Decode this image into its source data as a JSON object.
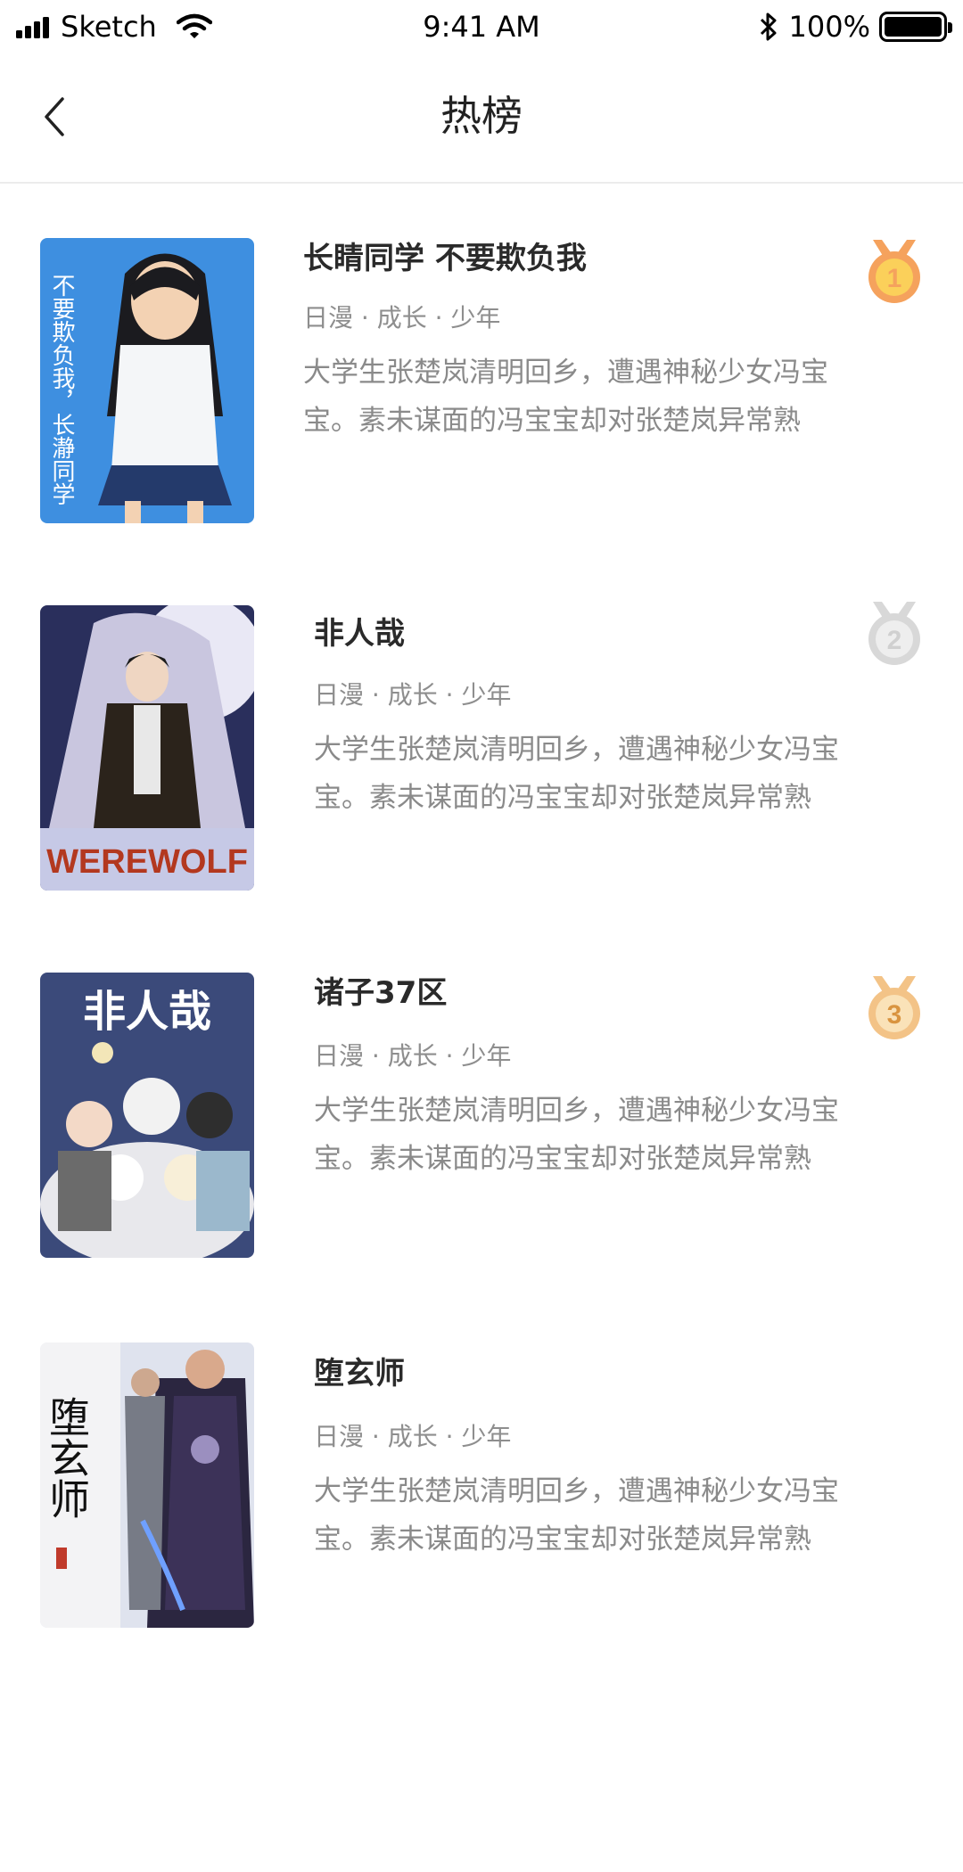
{
  "status_bar": {
    "carrier": "Sketch",
    "time": "9:41 AM",
    "battery": "100%",
    "icons": [
      "signal-icon",
      "wifi-icon",
      "bluetooth-icon",
      "battery-icon"
    ]
  },
  "nav": {
    "title": "热榜",
    "back_icon": "chevron-left-icon"
  },
  "rank_list": [
    {
      "rank": "1",
      "title": "长睛同学 不要欺负我",
      "tags": "日漫 · 成长 · 少年",
      "description": "大学生张楚岚清明回乡，遭遇神秘少女冯宝宝。素未谋面的冯宝宝却对张楚岚异常熟",
      "cover_text": "不要欺负我，长瀞同学",
      "medal_color": "#f5a25d"
    },
    {
      "rank": "2",
      "title": "非人哉",
      "tags": "日漫 · 成长 · 少年",
      "description": "大学生张楚岚清明回乡，遭遇神秘少女冯宝宝。素未谋面的冯宝宝却对张楚岚异常熟",
      "cover_text": "WEREWOLF",
      "medal_color": "#d8d8d8"
    },
    {
      "rank": "3",
      "title": "诸子37区",
      "tags": "日漫 · 成长 · 少年",
      "description": "大学生张楚岚清明回乡，遭遇神秘少女冯宝宝。素未谋面的冯宝宝却对张楚岚异常熟",
      "cover_text": "非人哉",
      "medal_color": "#f3c387"
    },
    {
      "rank": "",
      "title": "堕玄师",
      "tags": "日漫 · 成长 · 少年",
      "description": "大学生张楚岚清明回乡，遭遇神秘少女冯宝宝。素未谋面的冯宝宝却对张楚岚异常熟",
      "cover_text": "堕玄师",
      "medal_color": ""
    }
  ]
}
